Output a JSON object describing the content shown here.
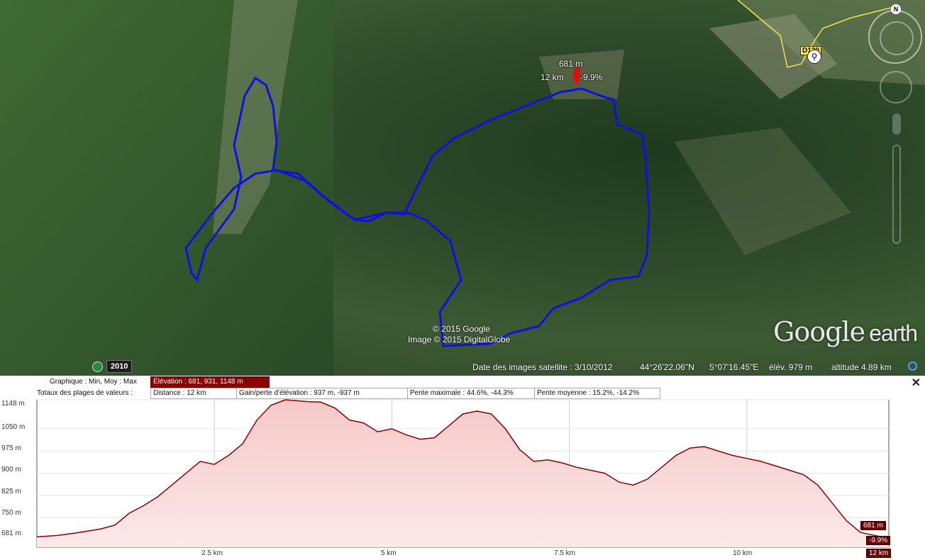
{
  "map": {
    "copyright_1": "© 2015 Google",
    "copyright_2": "Image © 2015 DigitalGlobe",
    "logo_google": "Google",
    "logo_earth": "earth",
    "year_button": "2010",
    "road_label": "D120",
    "marker": {
      "elevation": "681 m",
      "distance": "12 km",
      "slope": "-9.9%"
    },
    "status": {
      "imagery_date": "Date des images satellite : 3/10/2012",
      "lat": "44°26'22.06\"N",
      "lon": "5°07'16.45\"E",
      "elev": "élév.  979 m",
      "altitude": "altitude   4.89 km"
    },
    "route_color": "#1010e0"
  },
  "profile": {
    "graph_label": "Graphique : Min, Moy : Max",
    "elevation_summary": "Élévation : 681, 931, 1148 m",
    "totals_label": "Totaux des plages de valeurs :",
    "distance": "Distance : 12 km",
    "gain_loss": "Gain/perte d'élévation : 937 m, -937 m",
    "max_slope": "Pente maximale : 44.6%, -44.3%",
    "avg_slope": "Pente moyenne : 15.2%, -14.2%",
    "close": "✕",
    "cursor_tags": {
      "elevation": "681 m",
      "slope": "-9.9%",
      "distance": "12 km"
    },
    "accent": "#8b0000"
  },
  "chart_data": {
    "type": "area",
    "xlabel": "",
    "ylabel": "",
    "xlim": [
      0,
      12
    ],
    "ylim": [
      650,
      1148
    ],
    "x_ticks": [
      "2.5 km",
      "5 km",
      "7.5 km",
      "10 km"
    ],
    "y_ticks": [
      "1148 m",
      "1050 m",
      "975 m",
      "900 m",
      "825 m",
      "750 m",
      "681 m"
    ],
    "x": [
      0,
      0.3,
      0.6,
      0.9,
      1.1,
      1.3,
      1.5,
      1.7,
      1.9,
      2.1,
      2.3,
      2.5,
      2.7,
      2.9,
      3.1,
      3.3,
      3.5,
      3.8,
      4.0,
      4.2,
      4.4,
      4.6,
      4.8,
      5.0,
      5.2,
      5.4,
      5.6,
      5.8,
      6.0,
      6.2,
      6.4,
      6.6,
      6.8,
      7.0,
      7.2,
      7.4,
      7.6,
      7.8,
      8.0,
      8.2,
      8.4,
      8.6,
      8.8,
      9.0,
      9.2,
      9.4,
      9.6,
      9.8,
      10.0,
      10.2,
      10.4,
      10.6,
      10.8,
      11.0,
      11.2,
      11.4,
      11.6,
      11.8,
      12.0
    ],
    "values": [
      685,
      690,
      700,
      712,
      725,
      765,
      790,
      820,
      860,
      900,
      940,
      930,
      960,
      1000,
      1080,
      1130,
      1148,
      1142,
      1140,
      1120,
      1080,
      1070,
      1040,
      1050,
      1030,
      1015,
      1020,
      1060,
      1100,
      1110,
      1100,
      1050,
      980,
      940,
      945,
      935,
      920,
      910,
      900,
      870,
      860,
      880,
      920,
      960,
      985,
      990,
      975,
      960,
      950,
      940,
      925,
      910,
      895,
      860,
      800,
      740,
      700,
      690,
      681
    ]
  }
}
